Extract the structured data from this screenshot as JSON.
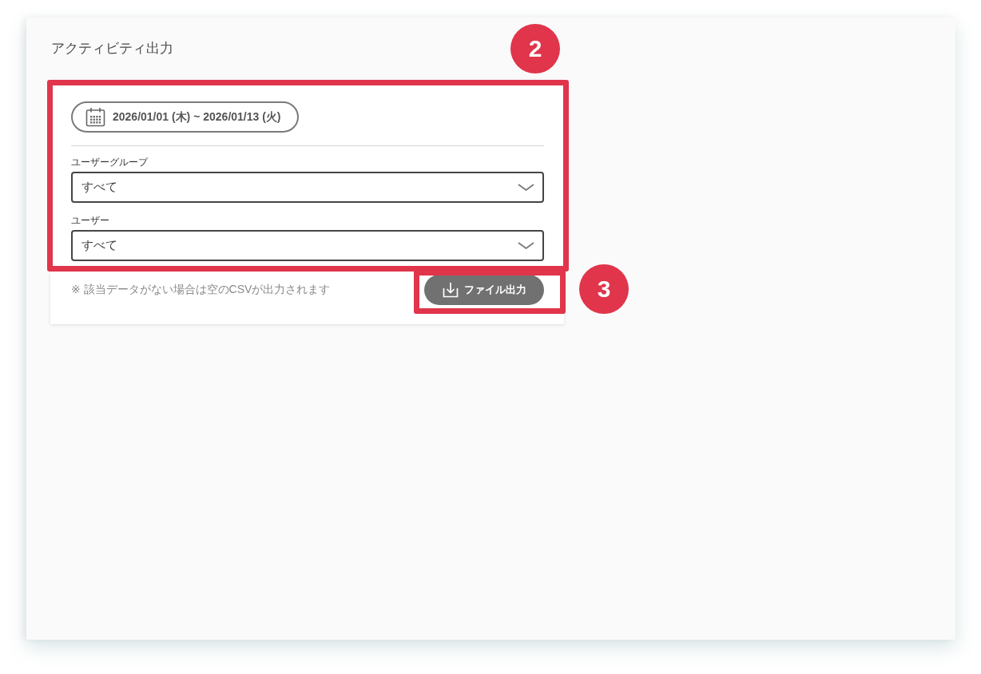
{
  "title": "アクティビティ出力",
  "form": {
    "callout": "2",
    "date_range": {
      "label": "2026/01/01 (木) ~ 2026/01/13 (火)"
    },
    "filters": [
      {
        "label": "ユーザーグループ",
        "value": "すべて"
      },
      {
        "label": "ユーザー",
        "value": "すべて"
      }
    ]
  },
  "note": "※ 該当データがない場合は空のCSVが出力されます",
  "export_button": {
    "label": "ファイル出力",
    "callout": "3"
  }
}
